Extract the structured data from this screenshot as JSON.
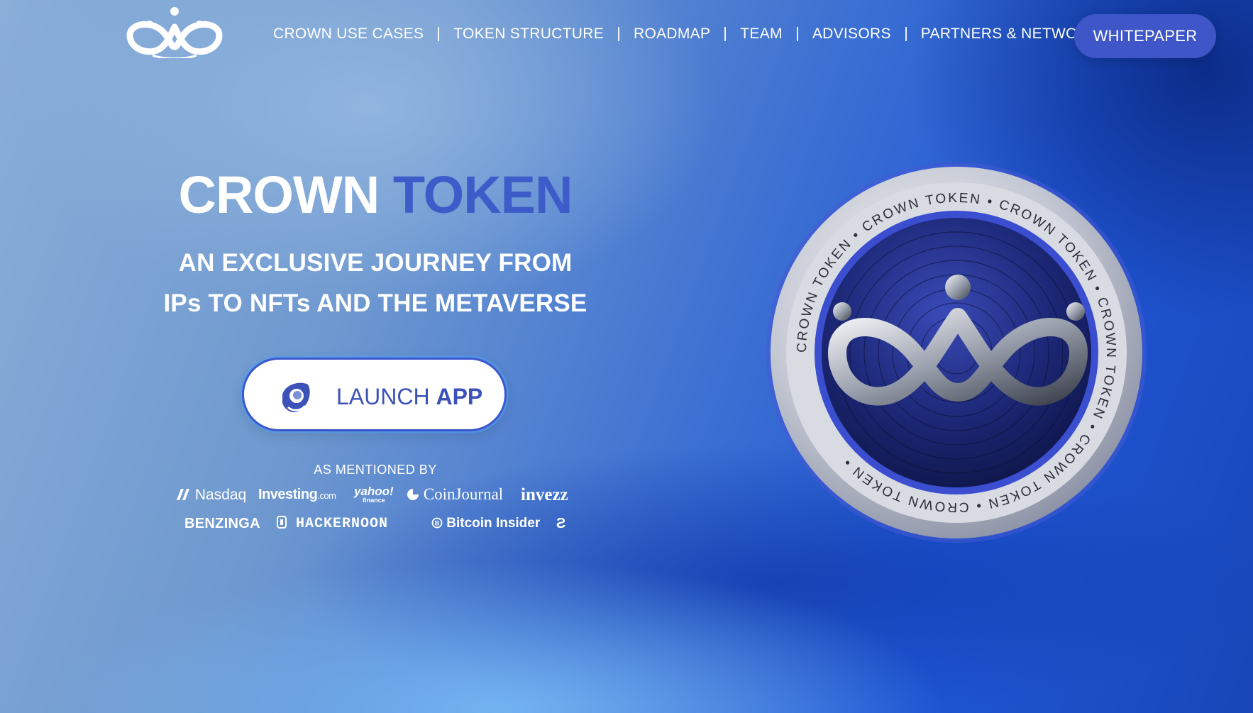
{
  "nav": {
    "logo_name": "crown-logo",
    "items": [
      {
        "label": "CROWN USE CASES"
      },
      {
        "label": "TOKEN STRUCTURE"
      },
      {
        "label": "ROADMAP"
      },
      {
        "label": "TEAM"
      },
      {
        "label": "ADVISORS"
      },
      {
        "label": "PARTNERS & NETWORKS"
      }
    ],
    "whitepaper_label": "WHITEPAPER"
  },
  "hero": {
    "title_part1": "CROWN",
    "title_part2": "TOKEN",
    "subtitle_line1": "AN EXCLUSIVE JOURNEY FROM",
    "subtitle_line2": "IPs TO NFTs AND THE METAVERSE",
    "launch_part1": "LAUNCH",
    "launch_part2": "APP"
  },
  "mentioned": {
    "label": "AS MENTIONED BY",
    "row1": [
      {
        "name": "Nasdaq"
      },
      {
        "name": "Investing",
        "suffix": ".com"
      },
      {
        "name": "yahoo!",
        "sub": "finance"
      },
      {
        "name": "CoinJournal"
      },
      {
        "name": "invezz"
      }
    ],
    "row2": [
      {
        "name": "BENZINGA"
      },
      {
        "name": "HACKERNOON"
      },
      {
        "name": "Bitcoin Insider"
      },
      {
        "name": "Ƨ"
      }
    ]
  },
  "coin": {
    "ring_text": "CROWN TOKEN",
    "colors": {
      "rim": "#c9ccd6",
      "face": "#24317e",
      "accent": "#3d5cc9"
    }
  },
  "colors": {
    "accent": "#3d5cc9",
    "button": "#3e56c8",
    "text": "#ffffff"
  }
}
